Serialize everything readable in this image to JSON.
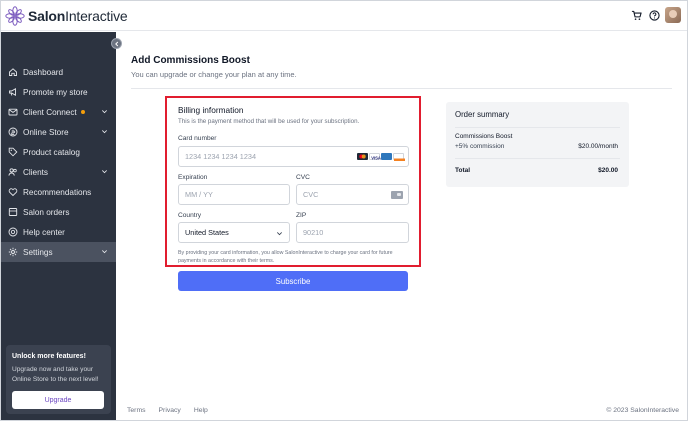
{
  "app": {
    "brand_name": "Salon",
    "brand_suffix": "Interactive",
    "colors": {
      "sidebar_bg": "#2c3340",
      "accent": "#4f6ef7",
      "highlight_border": "#e11d2f",
      "promo_link": "#6b46c1"
    }
  },
  "topbar": {
    "icons": [
      "cart-icon",
      "help-icon",
      "user-avatar"
    ]
  },
  "sidebar": {
    "items": [
      {
        "label": "Dashboard",
        "icon": "home-icon"
      },
      {
        "label": "Promote my store",
        "icon": "megaphone-icon"
      },
      {
        "label": "Client Connect",
        "icon": "mail-icon",
        "has_dot": true,
        "has_chevron": true
      },
      {
        "label": "Online Store",
        "icon": "store-icon",
        "has_chevron": true
      },
      {
        "label": "Product catalog",
        "icon": "tag-icon"
      },
      {
        "label": "Clients",
        "icon": "users-icon",
        "has_chevron": true
      },
      {
        "label": "Recommendations",
        "icon": "heart-icon"
      },
      {
        "label": "Salon orders",
        "icon": "box-icon"
      },
      {
        "label": "Help center",
        "icon": "help-circle-icon"
      },
      {
        "label": "Settings",
        "icon": "gear-icon",
        "has_chevron": true,
        "active": true
      }
    ],
    "promo": {
      "title": "Unlock more features!",
      "text": "Upgrade now and take your Online Store to the next level!",
      "button": "Upgrade"
    }
  },
  "main": {
    "title": "Add Commissions Boost",
    "subtitle": "You can upgrade or change your plan at any time.",
    "billing": {
      "title": "Billing information",
      "subtitle": "This is the payment method that will be used for your subscription.",
      "card_number_label": "Card number",
      "card_number_placeholder": "1234 1234 1234 1234",
      "card_brands": [
        "mastercard-icon",
        "visa-icon",
        "amex-icon",
        "discover-icon"
      ],
      "expiration_label": "Expiration",
      "expiration_placeholder": "MM / YY",
      "cvc_label": "CVC",
      "cvc_placeholder": "CVC",
      "country_label": "Country",
      "country_value": "United States",
      "zip_label": "ZIP",
      "zip_placeholder": "90210",
      "fine_print": "By providing your card information, you allow SalonInteractive to charge your card for future payments in accordance with their terms."
    },
    "subscribe_label": "Subscribe",
    "summary": {
      "title": "Order summary",
      "item_name": "Commissions Boost",
      "item_detail": "+5% commission",
      "item_price": "$20.00/month",
      "total_label": "Total",
      "total_value": "$20.00"
    }
  },
  "footer": {
    "links": [
      "Terms",
      "Privacy",
      "Help"
    ],
    "copyright": "© 2023 SalonInteractive"
  }
}
